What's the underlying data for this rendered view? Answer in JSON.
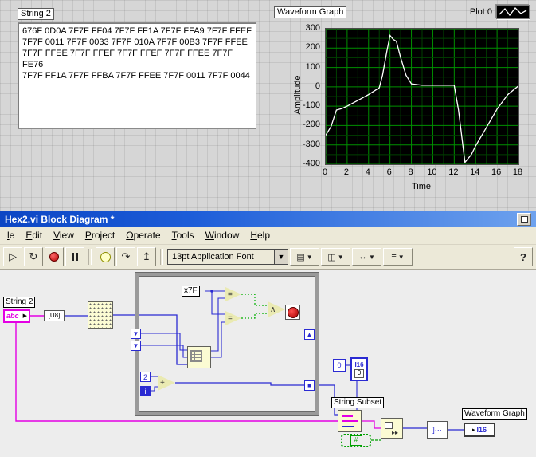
{
  "front_panel": {
    "string_control": {
      "label": "String 2",
      "lines": [
        "676F 0D0A 7F7F FF04 7F7F FF1A 7F7F FFA9 7F7F FFEF",
        "7F7F 0011 7F7F 0033 7F7F 010A 7F7F 00B3 7F7F FFEE",
        "7F7F FFEE 7F7F FFEF 7F7F FFEF 7F7F FFEE 7F7F FE76",
        "7F7F FF1A 7F7F FFBA 7F7F FFEE 7F7F 0011 7F7F 0044"
      ]
    },
    "graph": {
      "title": "Waveform Graph",
      "legend_label": "Plot 0"
    }
  },
  "chart_data": {
    "type": "line",
    "title": "Waveform Graph",
    "xlabel": "Time",
    "ylabel": "Amplitude",
    "xlim": [
      0,
      18
    ],
    "ylim": [
      -400,
      300
    ],
    "xticks": [
      0,
      2,
      4,
      6,
      8,
      10,
      12,
      14,
      16,
      18
    ],
    "yticks": [
      300,
      200,
      100,
      0,
      -100,
      -200,
      -300,
      -400
    ],
    "x": [
      0,
      0.5,
      1,
      1.5,
      2,
      3,
      4,
      5,
      5.3,
      5.7,
      6,
      6.3,
      6.6,
      7,
      7.5,
      8,
      9,
      10,
      11,
      12,
      12.4,
      13,
      13.6,
      14,
      15,
      16,
      17,
      18
    ],
    "y": [
      -250,
      -205,
      -120,
      -112,
      -100,
      -70,
      -40,
      -5,
      60,
      180,
      265,
      245,
      235,
      150,
      60,
      15,
      8,
      8,
      8,
      8,
      -120,
      -390,
      -350,
      -305,
      -210,
      -115,
      -40,
      5
    ],
    "line_color": "#ffffff",
    "plot_bg": "#000000",
    "grid_major": "#009000",
    "grid_minor": "#004000",
    "legend": "Plot 0",
    "legend_position": "top-right",
    "grid": true
  },
  "window": {
    "title": "Hex2.vi Block Diagram *",
    "menus": [
      "le",
      "Edit",
      "View",
      "Project",
      "Operate",
      "Tools",
      "Window",
      "Help"
    ],
    "toolbar": {
      "font_selector": "13pt Application Font",
      "help": "?"
    }
  },
  "diagram": {
    "string2_label": "String 2",
    "string_terminal": "abc",
    "u8": "[U8]",
    "x7f": "x7F",
    "const2": "2",
    "iter": "i",
    "zero": "0",
    "i16_const": "I16",
    "i16_const_value": "0",
    "string_subset": "String Subset",
    "waveform_graph": "Waveform Graph",
    "i16_indicator": "I16",
    "equal_glyph": "=",
    "and_glyph": "∧",
    "add_glyph": "+"
  }
}
